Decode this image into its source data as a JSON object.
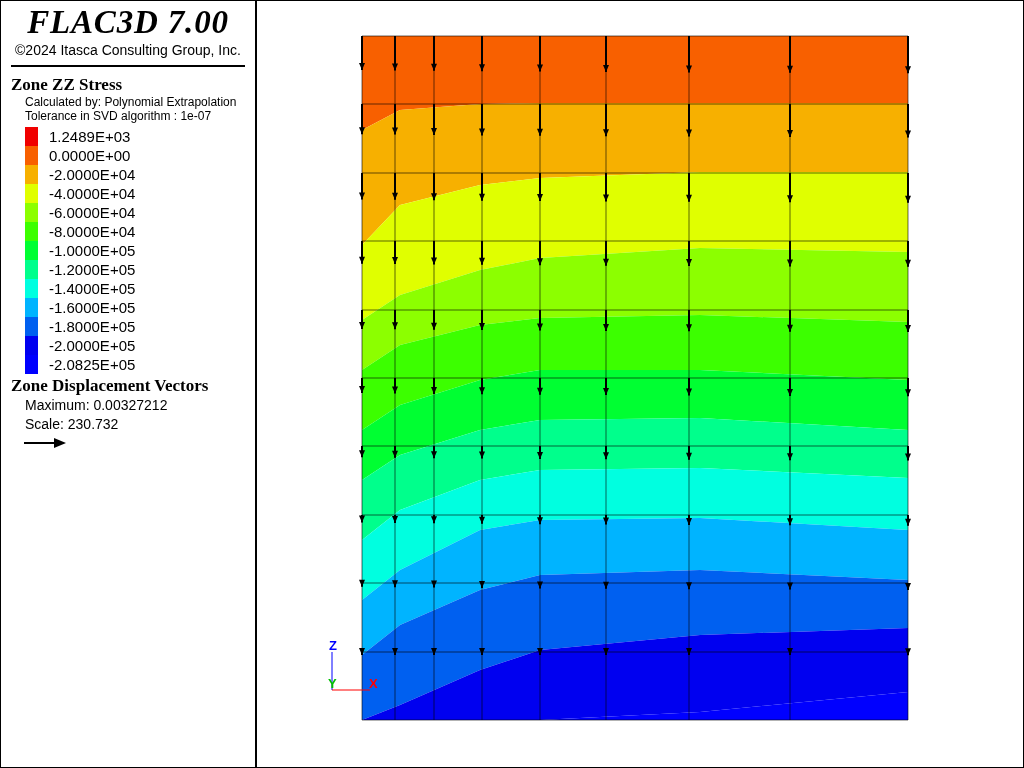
{
  "title": "FLAC3D 7.00",
  "copyright": "©2024 Itasca Consulting Group, Inc.",
  "legend": {
    "title": "Zone ZZ Stress",
    "notes": [
      "Calculated by: Polynomial Extrapolation",
      "Tolerance in SVD algorithm : 1e-07"
    ],
    "entries": [
      {
        "label": "1.2489E+03",
        "color": "#f00000"
      },
      {
        "label": "0.0000E+00",
        "color": "#f86000"
      },
      {
        "label": "-2.0000E+04",
        "color": "#f7b000"
      },
      {
        "label": "-4.0000E+04",
        "color": "#e0ff00"
      },
      {
        "label": "-6.0000E+04",
        "color": "#8cff00"
      },
      {
        "label": "-8.0000E+04",
        "color": "#3cff00"
      },
      {
        "label": "-1.0000E+05",
        "color": "#00ff32"
      },
      {
        "label": "-1.2000E+05",
        "color": "#00ff8c"
      },
      {
        "label": "-1.4000E+05",
        "color": "#00ffe0"
      },
      {
        "label": "-1.6000E+05",
        "color": "#00b4ff"
      },
      {
        "label": "-1.8000E+05",
        "color": "#0060f0"
      },
      {
        "label": "-2.0000E+05",
        "color": "#0000f0"
      },
      {
        "label": "-2.0825E+05",
        "color": "#0000ff"
      }
    ]
  },
  "vectors": {
    "title": "Zone Displacement Vectors",
    "lines": [
      "Maximum: 0.00327212",
      "Scale: 230.732"
    ]
  },
  "axes": [
    {
      "label": "Z",
      "color": "#0000ff"
    },
    {
      "label": "Y",
      "color": "#00c000"
    },
    {
      "label": "X",
      "color": "#ff0000"
    }
  ]
}
